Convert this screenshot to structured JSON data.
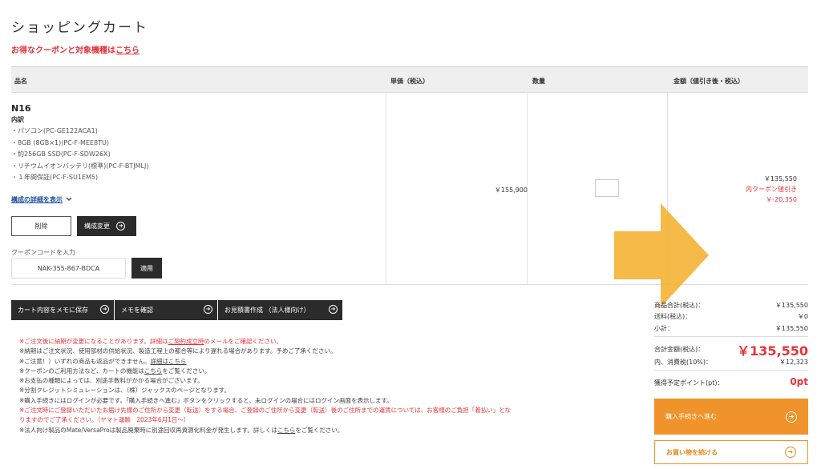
{
  "page": {
    "title": "ショッピングカート",
    "coupon_promo_prefix": "お得なクーポンと対象機種は",
    "coupon_promo_link": "こちら"
  },
  "table": {
    "headers": {
      "product": "品名",
      "unit_price": "単価（税込）",
      "quantity": "数量",
      "amount": "金額（値引き後・税込）"
    }
  },
  "item": {
    "name": "N16",
    "breakdown_label": "内訳",
    "specs": [
      "・パソコン(PC-GE122ACA1)",
      "・8GB (8GB×1)(PC-F-MEE8TU)",
      "・約256GB SSD(PC-F-SDW26X)",
      "・リチウムイオンバッテリ(標準)(PC-F-BTJMLJ)",
      "・１年間保証(PC-F-SU1EM5)"
    ],
    "details_link": "構成の詳細を表示",
    "delete_label": "削除",
    "config_label": "構成変更",
    "unit_price": "￥155,900",
    "amount": "￥135,550",
    "coupon_discount_label": "内クーポン値引き",
    "coupon_discount_value": "￥-20,350"
  },
  "coupon": {
    "label": "クーポンコードを入力",
    "value": "NAK-355-867-BDCA",
    "apply_label": "適用"
  },
  "actions": {
    "save_memo": "カート内容をメモに保存",
    "check_memo": "メモを確認",
    "estimate": "お見積書作成 （法人様向け）"
  },
  "notices": [
    {
      "type": "red",
      "pre": "※ご注文後に納期が変更になることがあります。詳細は",
      "link": "ご契約成立時",
      "post": "のメールをご確認ください。"
    },
    {
      "type": "normal",
      "pre": "※納期はご注文状況、使用部材の供給状況、製造工程上の都合等により遅れる場合があります。予めご了承ください。",
      "link": "",
      "post": ""
    },
    {
      "type": "normal",
      "pre": "※ご注意！）いずれの商品も返品ができません。",
      "link": "詳細はこちら",
      "post": ""
    },
    {
      "type": "normal",
      "pre": "※クーポンのご利用方法など、カートの機能は",
      "link": "こちら",
      "post": "をご覧ください。"
    },
    {
      "type": "normal",
      "pre": "※お支払の種類によっては、別途手数料がかかる場合がございます。",
      "link": "",
      "post": ""
    },
    {
      "type": "normal",
      "pre": "※分割クレジットシミュレーションは、（株）ジャックスのページとなります。",
      "link": "",
      "post": ""
    },
    {
      "type": "normal",
      "pre": "※購入手続きにはログインが必要です。「購入手続きへ進む」ボタンをクリックすると、未ログインの場合にはログイン画面を表示します。",
      "link": "",
      "post": ""
    },
    {
      "type": "red",
      "pre": "※ご注文時にご登録いただいたお届け先様のご住所から変更（転送）をする場合、ご登録のご住所から変更（転送）後のご住所までの運賃については、お客様のご負担「着払い」とな",
      "link": "",
      "post": ""
    },
    {
      "type": "red",
      "pre": "りますのでご了承ください。（ヤマト運輸　2023年6月1日～）",
      "link": "",
      "post": ""
    },
    {
      "type": "normal",
      "pre": "※法人向け製品のMate/VersaProは製品廃棄時に別途回収再資源化料金が発生します。詳しくは",
      "link": "こちら",
      "post": "をご覧ください。"
    }
  ],
  "summary": {
    "subtotal_label": "商品合計(税込)：",
    "subtotal_value": "￥135,550",
    "shipping_label": "送料(税込)：",
    "shipping_value": "￥0",
    "small_total_label": "小計：",
    "small_total_value": "￥135,550",
    "total_label": "合計金額(税込)：",
    "total_value": "￥135,550",
    "tax_label": "内、消費税(10%)：",
    "tax_value": "￥12,323",
    "points_label": "獲得予定ポイント(pt)：",
    "points_value": "0pt"
  },
  "buttons": {
    "checkout": "購入手続きへ進む",
    "continue": "お買い物を続ける"
  },
  "colors": {
    "accent_red": "#e8333b",
    "checkout_orange": "#f0932b",
    "overlay_arrow": "#f5b335",
    "dark_button": "#2b2b2b"
  },
  "icons": {
    "circle_arrow": "circle-arrow-right-icon",
    "chevron": "chevron-down-icon",
    "overlay": "arrow-right-icon"
  }
}
